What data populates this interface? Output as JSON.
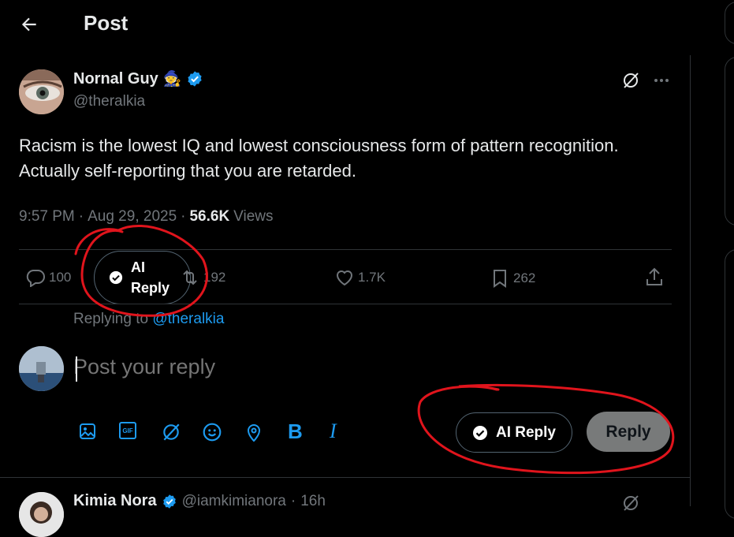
{
  "header": {
    "title": "Post"
  },
  "post": {
    "author_name": "Nornal Guy",
    "author_emoji": "🧙",
    "handle": "@theralkia",
    "text": "Racism is the lowest IQ and lowest consciousness form of pattern recognition. Actually self-reporting that you are retarded.",
    "time": "9:57 PM",
    "date": "Aug 29, 2025",
    "separator": "·",
    "views_count": "56.6K",
    "views_label": "Views"
  },
  "actions": {
    "replies": "100",
    "ai_reply_line1": "AI",
    "ai_reply_line2": "Reply",
    "reposts": "192",
    "likes": "1.7K",
    "bookmarks": "262"
  },
  "compose": {
    "replying_prefix": "Replying to",
    "replying_handle": "@theralkia",
    "placeholder": "Post your reply",
    "ai_reply_label": "AI Reply",
    "reply_label": "Reply",
    "bold_label": "B",
    "italic_label": "I",
    "gif_label": "GIF"
  },
  "next_post": {
    "author_name": "Kimia Nora",
    "handle": "@iamkimianora",
    "separator": "·",
    "time": "16h"
  },
  "colors": {
    "accent": "#1d9bf0",
    "annotation": "#e0141c",
    "background": "#000000",
    "muted": "#71767b"
  }
}
